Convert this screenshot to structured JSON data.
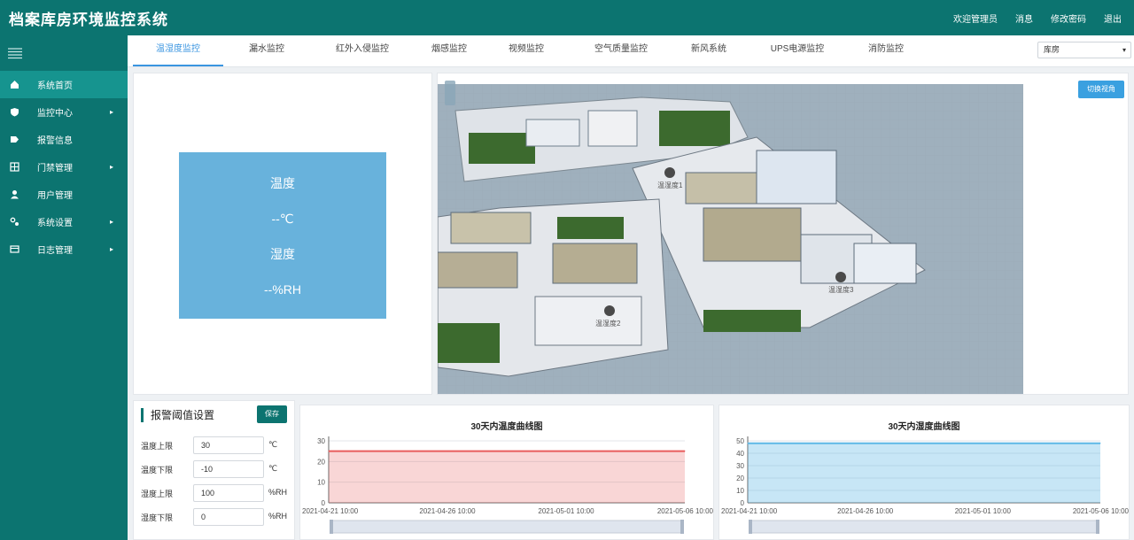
{
  "header": {
    "title": "档案库房环境监控系统",
    "links": [
      "欢迎管理员",
      "消息",
      "修改密码",
      "退出"
    ]
  },
  "sidebar": {
    "items": [
      {
        "label": "系统首页",
        "icon": "home-icon",
        "arrow": ""
      },
      {
        "label": "监控中心",
        "icon": "shield-icon",
        "arrow": "▸"
      },
      {
        "label": "报警信息",
        "icon": "alarm-icon",
        "arrow": ""
      },
      {
        "label": "门禁管理",
        "icon": "door-icon",
        "arrow": "▸"
      },
      {
        "label": "用户管理",
        "icon": "user-icon",
        "arrow": ""
      },
      {
        "label": "系统设置",
        "icon": "settings-icon",
        "arrow": "▸"
      },
      {
        "label": "日志管理",
        "icon": "log-icon",
        "arrow": "▸"
      }
    ]
  },
  "tabs": [
    "温湿度监控",
    "漏水监控",
    "红外入侵监控",
    "烟感监控",
    "视频监控",
    "空气质量监控",
    "新风系统",
    "UPS电源监控",
    "消防监控"
  ],
  "select": {
    "value": "库房"
  },
  "sensor": {
    "temp_label": "温度",
    "temp_value": "--℃",
    "humidity_label": "湿度",
    "humidity_value": "--%RH"
  },
  "scene": {
    "view_button": "切换视角",
    "sensor_labels": [
      "温湿度1",
      "温湿度2",
      "温湿度3"
    ]
  },
  "threshold": {
    "title": "报警阈值设置",
    "save_label": "保存",
    "rows": [
      {
        "label": "温度上限",
        "value": "30",
        "unit": "℃"
      },
      {
        "label": "温度下限",
        "value": "-10",
        "unit": "℃"
      },
      {
        "label": "湿度上限",
        "value": "100",
        "unit": "%RH"
      },
      {
        "label": "湿度下限",
        "value": "0",
        "unit": "%RH"
      }
    ]
  },
  "colors": {
    "brand": "#0c7470",
    "accent": "#3a95e0",
    "temp_series": "#e85c5c",
    "humidity_series": "#5fb8e6"
  },
  "chart_data": [
    {
      "type": "area",
      "title": "30天内温度曲线图",
      "x": [
        "2021-04-21 10:00",
        "2021-04-26 10:00",
        "2021-05-01 10:00",
        "2021-05-06 10:00"
      ],
      "series": [
        {
          "values": [
            25,
            25,
            25,
            25
          ]
        }
      ],
      "yticks": [
        0,
        10,
        20,
        30
      ],
      "ylim": [
        0,
        30
      ],
      "grid": true
    },
    {
      "type": "area",
      "title": "30天内湿度曲线图",
      "x": [
        "2021-04-21 10:00",
        "2021-04-26 10:00",
        "2021-05-01 10:00",
        "2021-05-06 10:00"
      ],
      "series": [
        {
          "values": [
            48,
            48,
            48,
            48
          ]
        }
      ],
      "yticks": [
        0,
        10,
        20,
        30,
        40,
        50
      ],
      "ylim": [
        0,
        50
      ],
      "grid": true
    }
  ]
}
